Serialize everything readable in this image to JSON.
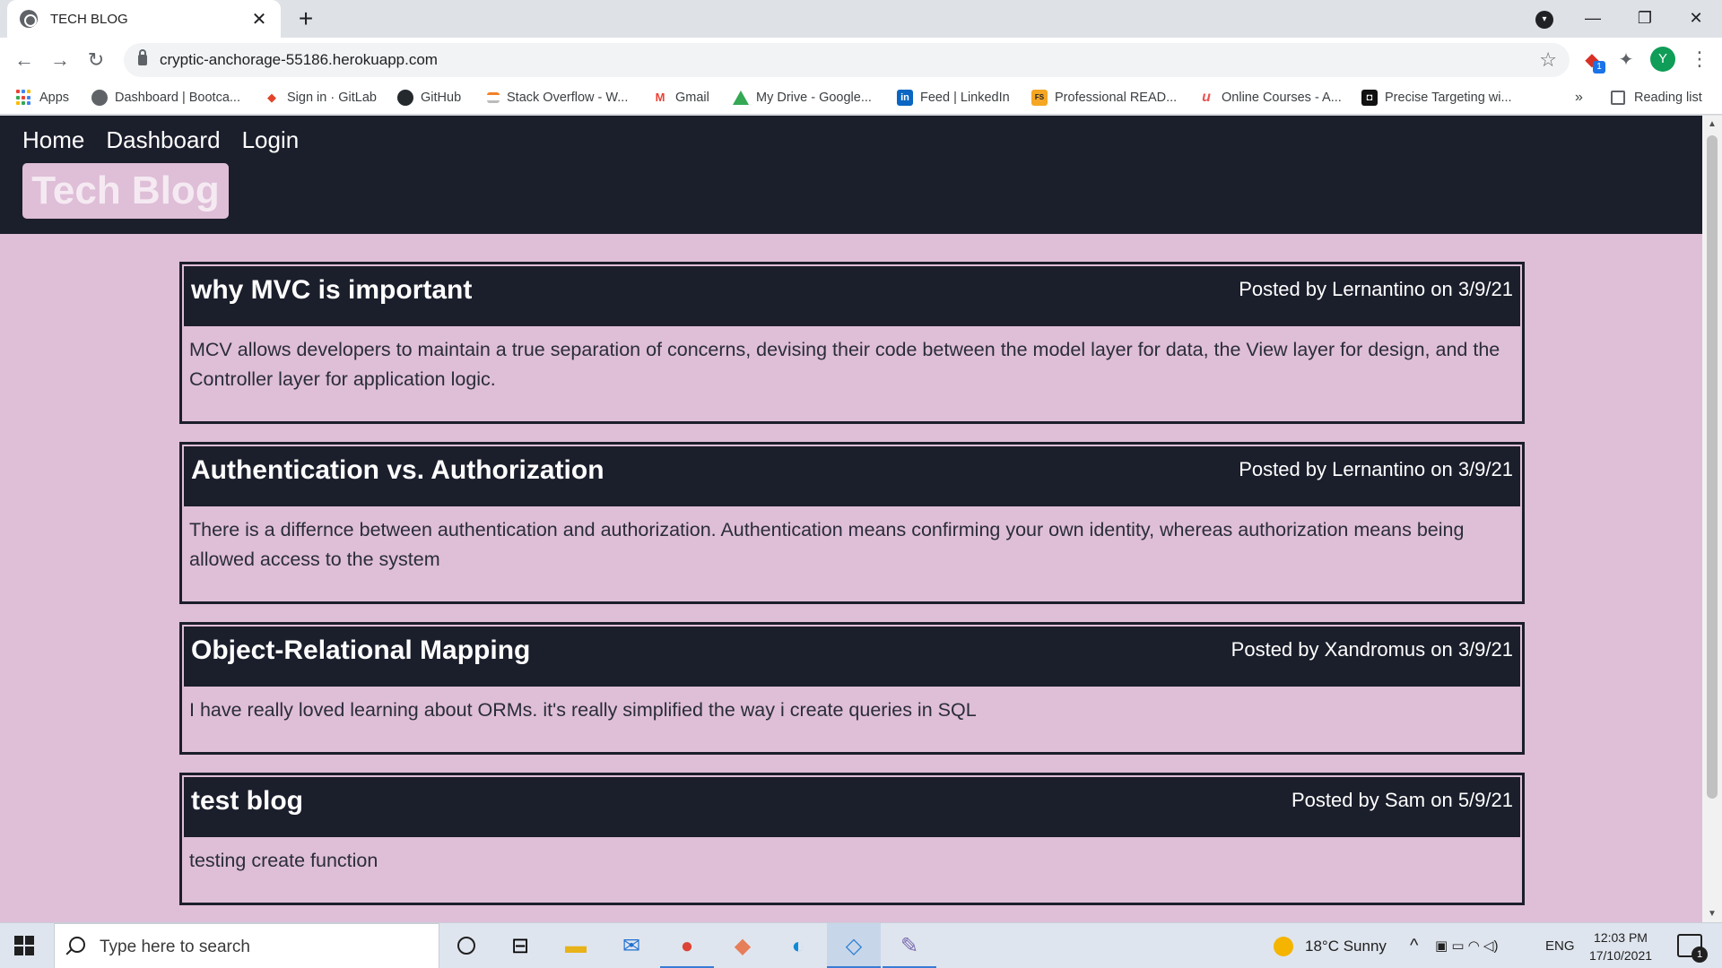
{
  "browser": {
    "tab_title": "TECH BLOG",
    "tab_close": "✕",
    "new_tab": "+",
    "tab_search": "▾",
    "url": "cryptic-anchorage-55186.herokuapp.com",
    "back": "←",
    "forward": "→",
    "reload": "↻",
    "star": "☆",
    "window_min": "—",
    "window_restore": "❐",
    "window_close": "✕",
    "profile_initial": "Y",
    "menu": "⋮",
    "extension_badge": "1",
    "ext_puzzle": "✦"
  },
  "bookmarks": {
    "items": [
      {
        "label": "Apps"
      },
      {
        "label": "Dashboard | Bootca..."
      },
      {
        "label": "Sign in · GitLab"
      },
      {
        "label": "GitHub"
      },
      {
        "label": "Stack Overflow - W..."
      },
      {
        "label": "Gmail"
      },
      {
        "label": "My Drive - Google..."
      },
      {
        "label": "Feed | LinkedIn"
      },
      {
        "label": "Professional READ..."
      },
      {
        "label": "Online Courses - A..."
      },
      {
        "label": "Precise Targeting wi..."
      }
    ],
    "overflow": "»",
    "reading_list": "Reading list",
    "linkedin_glyph": "in",
    "gmail_glyph": "M",
    "gitlab_glyph": "◆",
    "fs_glyph": "FS",
    "udemy_glyph": "u",
    "precise_glyph": "◘"
  },
  "site": {
    "nav": {
      "home": "Home",
      "dashboard": "Dashboard",
      "login": "Login"
    },
    "logo": "Tech Blog",
    "posts": [
      {
        "title": "why MVC is important",
        "meta": "Posted by Lernantino on 3/9/21",
        "body": "MCV allows developers to maintain a true separation of concerns, devising their code between the model layer for data, the View layer for design, and the Controller layer for application logic."
      },
      {
        "title": "Authentication vs. Authorization",
        "meta": "Posted by Lernantino on 3/9/21",
        "body": "There is a differnce between authentication and authorization. Authentication means confirming your own identity, whereas authorization means being allowed access to the system"
      },
      {
        "title": "Object-Relational Mapping",
        "meta": "Posted by Xandromus on 3/9/21",
        "body": "I have really loved learning about ORMs. it's really simplified the way i create queries in SQL"
      },
      {
        "title": "test blog",
        "meta": "Posted by Sam on 5/9/21",
        "body": "testing create function"
      }
    ]
  },
  "taskbar": {
    "search_placeholder": "Type here to search",
    "weather": "18°C  Sunny",
    "tray_caret": "^",
    "language": "ENG",
    "time": "12:03 PM",
    "date": "17/10/2021",
    "notification_count": "1",
    "task_view": "⊟",
    "explorer_glyph": "▬",
    "mail_glyph": "✉",
    "chrome_glyph": "●",
    "git_glyph": "◆",
    "edge_glyph": "◐",
    "vscode_glyph": "◇",
    "paint_glyph": "✎",
    "tray_icons": "▣  ▭  ◠  ◁)"
  },
  "colors": {
    "page_bg": "#dfbed8",
    "header_bg": "#1b1e2b",
    "logo_text": "#f5eaf2"
  }
}
